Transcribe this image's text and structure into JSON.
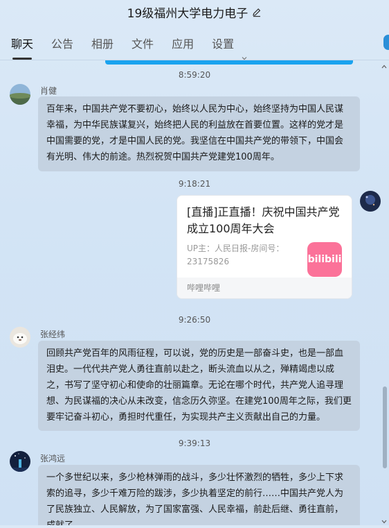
{
  "window": {
    "title": "19级福州大学电力电子"
  },
  "tabs": [
    {
      "label": "聊天"
    },
    {
      "label": "公告"
    },
    {
      "label": "相册"
    },
    {
      "label": "文件"
    },
    {
      "label": "应用"
    },
    {
      "label": "设置"
    }
  ],
  "messages": [
    {
      "time": "8:59:20",
      "sender": "肖健",
      "text": "百年来，中国共产党不要初心，始终以人民为中心，始终坚持为中国人民谋幸福，为中华民族谋复兴，始终把人民的利益放在首要位置。这样的党才是中国需要的党，才是中国人民的党。我坚信在中国共产党的带领下，中国会有光明、伟大的前途。热烈祝贺中国共产党建党100周年。"
    },
    {
      "time": "9:18:21",
      "card": {
        "title": "[直播]正直播！庆祝中国共产党成立100周年大会",
        "subtitle": "UP主：人民日报-房间号：23175826",
        "logo_text": "bilibili",
        "source": "哔哩哔哩"
      }
    },
    {
      "time": "9:26:50",
      "sender": "张经纬",
      "text": "回顾共产党百年的风雨征程，可以说，党的历史是一部奋斗史，也是一部血泪史。一代代共产党人勇往直前以赴之，断头流血以从之，殚精竭虑以成之，书写了坚守初心和使命的壮丽篇章。无论在哪个时代，共产党人追寻理想、为民谋福的决心从未改变，信念历久弥坚。在建党100周年之际，我们更要牢记奋斗初心，勇担时代重任，为实现共产主义贡献出自己的力量。"
    },
    {
      "time": "9:39:13",
      "sender": "张鸿远",
      "text": "一个多世纪以来，多少枪林弹雨的战斗，多少壮怀激烈的牺牲，多少上下求索的追寻，多少千难万险的跋涉，多少执着坚定的前行……中国共产党人为了民族独立、人民解放，为了国家富强、人民幸福，前赴后继、勇往直前，成就了"
    }
  ],
  "colors": {
    "bubble": "#c4d2e1",
    "accent": "#1aa3ef",
    "bilibili": "#fb7299"
  }
}
